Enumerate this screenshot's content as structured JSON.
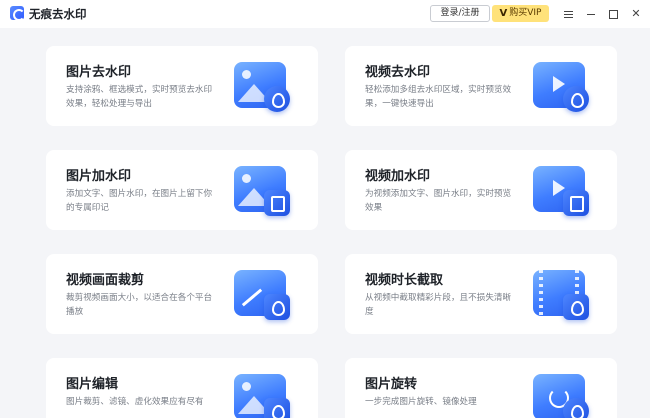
{
  "app": {
    "title": "无痕去水印",
    "login_label": "登录/注册",
    "vip_label": "购买VIP",
    "vip_mark": "V"
  },
  "cards": [
    {
      "title": "图片去水印",
      "desc": "支持涂鸦、框选模式，实时预览去水印效果，轻松处理与导出",
      "icon": "image-remove-watermark-icon"
    },
    {
      "title": "视频去水印",
      "desc": "轻松添加多组去水印区域，实时预览效果，一键快速导出",
      "icon": "video-remove-watermark-icon"
    },
    {
      "title": "图片加水印",
      "desc": "添加文字、图片水印，在图片上留下你的专属印记",
      "icon": "image-add-watermark-icon"
    },
    {
      "title": "视频加水印",
      "desc": "为视频添加文字、图片水印，实时预览效果",
      "icon": "video-add-watermark-icon"
    },
    {
      "title": "视频画面裁剪",
      "desc": "裁剪视频画面大小，以适合在各个平台播放",
      "icon": "video-crop-icon"
    },
    {
      "title": "视频时长截取",
      "desc": "从视频中截取精彩片段，且不损失清晰度",
      "icon": "video-trim-icon"
    },
    {
      "title": "图片编辑",
      "desc": "图片裁剪、滤镜、虚化效果应有尽有",
      "icon": "image-edit-icon"
    },
    {
      "title": "图片旋转",
      "desc": "一步完成图片旋转、镜像处理",
      "icon": "image-rotate-icon"
    }
  ],
  "colors": {
    "accent": "#3f7dff",
    "vip": "#ffe27a",
    "background": "#f4f5f8"
  }
}
